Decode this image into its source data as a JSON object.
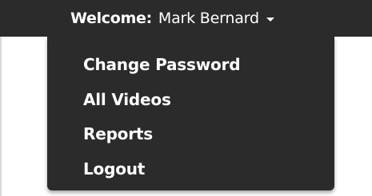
{
  "header": {
    "welcome_label": "Welcome:",
    "user_name": "Mark Bernard",
    "caret_icon": "caret-down-icon"
  },
  "dropdown": {
    "items": [
      {
        "label": "Change Password"
      },
      {
        "label": "All Videos"
      },
      {
        "label": "Reports"
      },
      {
        "label": "Logout"
      }
    ]
  },
  "colors": {
    "bar_background": "#2b2b2b",
    "text": "#ffffff",
    "page_background": "#ffffff"
  }
}
